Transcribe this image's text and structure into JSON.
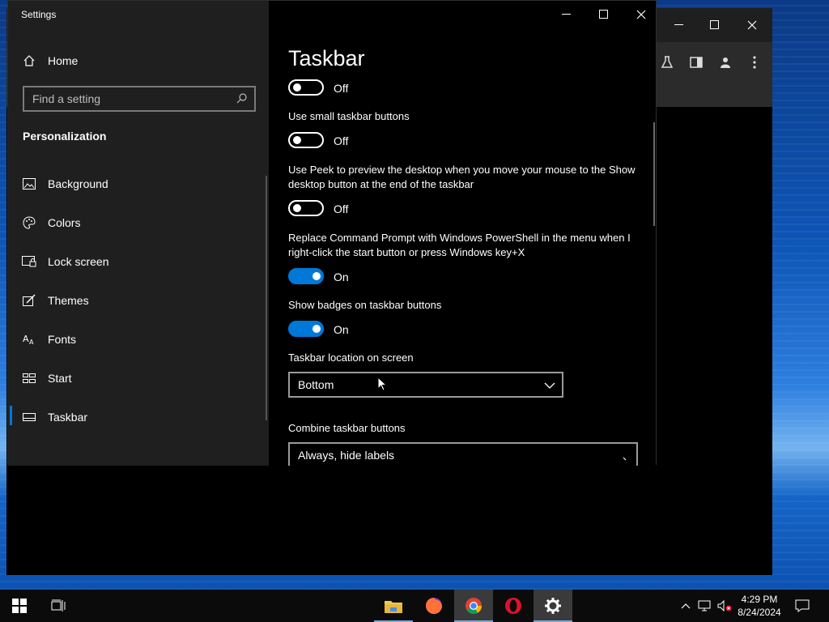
{
  "settings_window": {
    "title": "Settings",
    "controls": {
      "minimize": "minimize",
      "maximize": "maximize",
      "close": "close"
    }
  },
  "sidebar": {
    "home_label": "Home",
    "search_placeholder": "Find a setting",
    "section": "Personalization",
    "items": [
      {
        "label": "Background",
        "icon": "picture-icon",
        "active": false
      },
      {
        "label": "Colors",
        "icon": "palette-icon",
        "active": false
      },
      {
        "label": "Lock screen",
        "icon": "lock-screen-icon",
        "active": false
      },
      {
        "label": "Themes",
        "icon": "themes-icon",
        "active": false
      },
      {
        "label": "Fonts",
        "icon": "fonts-icon",
        "active": false
      },
      {
        "label": "Start",
        "icon": "start-icon",
        "active": false
      },
      {
        "label": "Taskbar",
        "icon": "taskbar-icon",
        "active": true
      }
    ]
  },
  "main": {
    "title": "Taskbar",
    "options": [
      {
        "label": "",
        "state": "Off",
        "on": false
      },
      {
        "label": "Use small taskbar buttons",
        "state": "Off",
        "on": false
      },
      {
        "label": "Use Peek to preview the desktop when you move your mouse to the Show desktop button at the end of the taskbar",
        "state": "Off",
        "on": false
      },
      {
        "label": "Replace Command Prompt with Windows PowerShell in the menu when I right-click the start button or press Windows key+X",
        "state": "On",
        "on": true
      },
      {
        "label": "Show badges on taskbar buttons",
        "state": "On",
        "on": true
      }
    ],
    "location_label": "Taskbar location on screen",
    "location_value": "Bottom",
    "combine_label": "Combine taskbar buttons",
    "combine_value": "Always, hide labels"
  },
  "taskbar": {
    "apps": [
      {
        "name": "start-button"
      },
      {
        "name": "task-view"
      },
      {
        "name": "file-explorer"
      },
      {
        "name": "firefox"
      },
      {
        "name": "chrome",
        "active": true
      },
      {
        "name": "opera"
      },
      {
        "name": "settings",
        "active": true
      }
    ],
    "time": "4:29 PM",
    "date": "8/24/2024"
  },
  "colors": {
    "accent": "#0078d7",
    "sidebar_bg": "#1f1f1f",
    "content_bg": "#000000"
  }
}
